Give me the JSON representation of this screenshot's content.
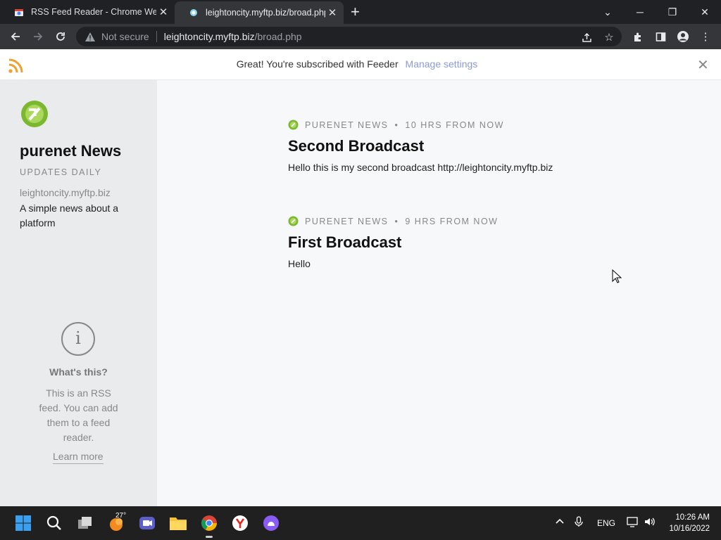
{
  "browser": {
    "tabs": [
      {
        "title": "RSS Feed Reader - Chrome Web",
        "active": false
      },
      {
        "title": "leightoncity.myftp.biz/broad.php",
        "active": true
      }
    ],
    "address": {
      "security_label": "Not secure",
      "host": "leightoncity.myftp.biz",
      "path": "/broad.php"
    }
  },
  "banner": {
    "message": "Great! You're subscribed with Feeder",
    "link": "Manage settings"
  },
  "sidebar": {
    "title": "purenet News",
    "frequency": "UPDATES DAILY",
    "host": "leightoncity.myftp.biz",
    "description": "A simple news about a platform",
    "info_heading": "What's this?",
    "info_text": "This is an RSS feed. You can add them to a feed reader.",
    "learn_more": "Learn more"
  },
  "items": [
    {
      "source": "PURENET NEWS",
      "time": "10 HRS FROM NOW",
      "title": "Second Broadcast",
      "body": "Hello this is my second broadcast http://leightoncity.myftp.biz"
    },
    {
      "source": "PURENET NEWS",
      "time": "9 HRS FROM NOW",
      "title": "First Broadcast",
      "body": "Hello"
    }
  ],
  "taskbar": {
    "weather_temp": "27°",
    "language": "ENG",
    "time": "10:26 AM",
    "date": "10/16/2022"
  },
  "colors": {
    "accent_link": "#8c9ad6",
    "rss_orange": "#f0a030",
    "logo_green": "#7cb82f"
  }
}
